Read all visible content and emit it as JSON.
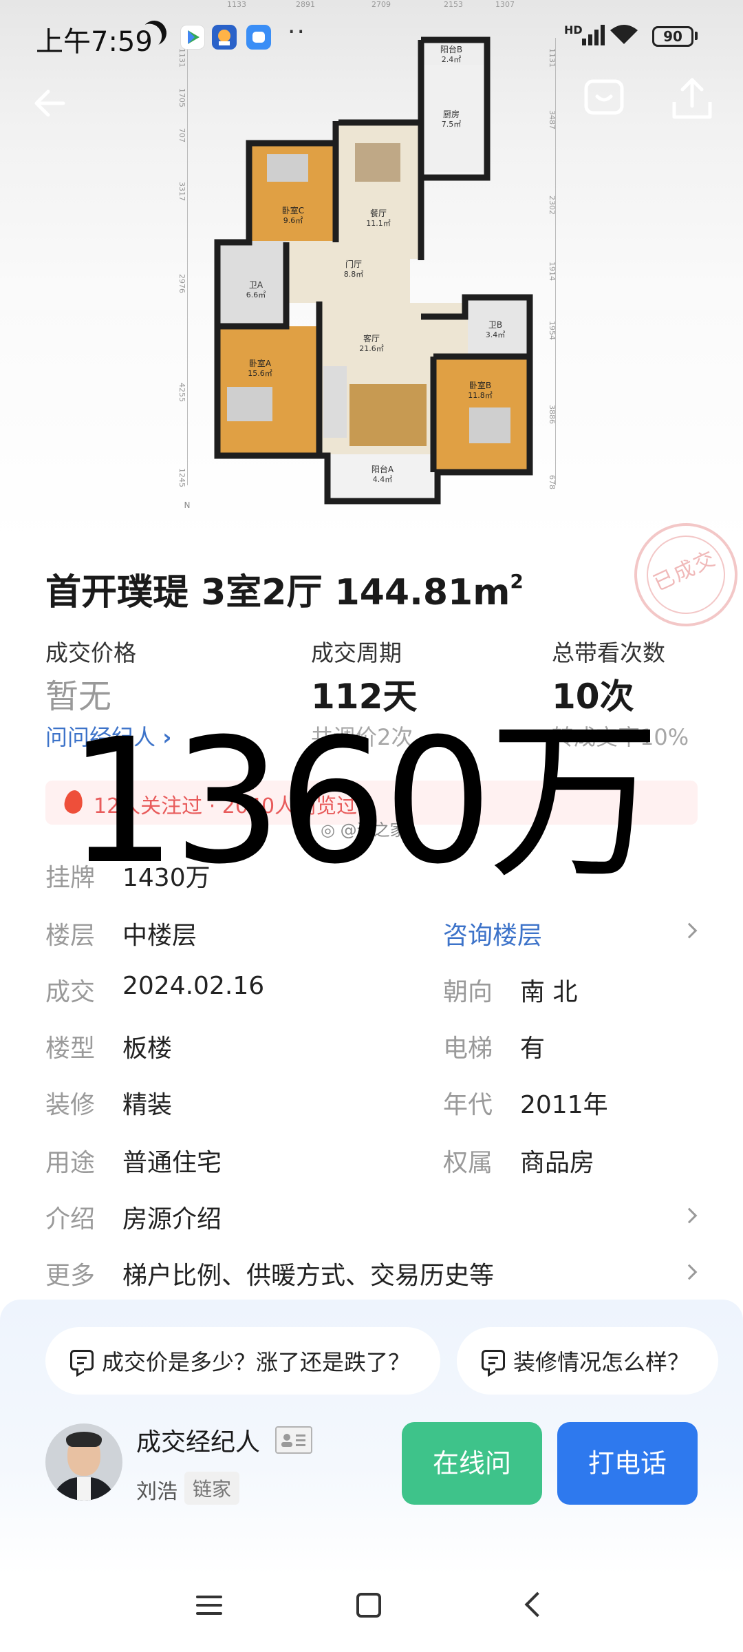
{
  "status_bar": {
    "time": "上午7:59",
    "network": "HD",
    "battery": "90"
  },
  "floor_plan": {
    "dims_top": [
      "1133",
      "2891",
      "2709",
      "2153",
      "1307"
    ],
    "dims_left": [
      "1131",
      "1705",
      "707",
      "3317",
      "2976",
      "4255",
      "1245"
    ],
    "dims_right": [
      "1131",
      "3487",
      "2302",
      "1914",
      "1954",
      "3886",
      "678"
    ],
    "rooms": [
      {
        "name": "阳台B",
        "area": "2.4㎡"
      },
      {
        "name": "厨房",
        "area": "7.5㎡"
      },
      {
        "name": "卧室C",
        "area": "9.6㎡"
      },
      {
        "name": "餐厅",
        "area": "11.1㎡"
      },
      {
        "name": "卫A",
        "area": "6.6㎡"
      },
      {
        "name": "门厅",
        "area": "8.8㎡"
      },
      {
        "name": "客厅",
        "area": "21.6㎡"
      },
      {
        "name": "卫B",
        "area": "3.4㎡"
      },
      {
        "name": "卧室A",
        "area": "15.6㎡"
      },
      {
        "name": "卧室B",
        "area": "11.8㎡"
      },
      {
        "name": "阳台A",
        "area": "4.4㎡"
      }
    ],
    "compass": "N"
  },
  "stamp": "已成交",
  "title": {
    "name": "首开璞瑅 3室2厅 144.81m",
    "sup": "2"
  },
  "stats": {
    "price_label": "成交价格",
    "price_value": "暂无",
    "price_link": "问问经纪人",
    "cycle_label": "成交周期",
    "cycle_value": "112天",
    "cycle_sub": "共调价2次",
    "views_label": "总带看次数",
    "views_value": "10次",
    "views_sub": "转成交率10%"
  },
  "attention": "12人关注过 · 2040人浏览过",
  "watermark": "@途之家",
  "overlay_price": "1360万",
  "details": {
    "listing_label": "挂牌",
    "listing_value": "1430万",
    "floor_label": "楼层",
    "floor_value": "中楼层",
    "floor_link": "咨询楼层",
    "deal_label": "成交",
    "deal_value": "2024.02.16",
    "orient_label": "朝向",
    "orient_value": "南 北",
    "type_label": "楼型",
    "type_value": "板楼",
    "elevator_label": "电梯",
    "elevator_value": "有",
    "deco_label": "装修",
    "deco_value": "精装",
    "year_label": "年代",
    "year_value": "2011年",
    "use_label": "用途",
    "use_value": "普通住宅",
    "owner_label": "权属",
    "owner_value": "商品房",
    "intro_label": "介绍",
    "intro_value": "房源介绍",
    "more_label": "更多",
    "more_value": "梯户比例、供暖方式、交易历史等"
  },
  "questions": [
    "成交价是多少？涨了还是跌了？",
    "装修情况怎么样？"
  ],
  "agent": {
    "title": "成交经纪人",
    "name": "刘浩",
    "company": "链家"
  },
  "buttons": {
    "online": "在线问",
    "call": "打电话"
  },
  "colors": {
    "link": "#3d73c9",
    "green_button": "#3ec38a",
    "blue_button": "#2e79ee",
    "alert_text": "#e85b5b"
  }
}
